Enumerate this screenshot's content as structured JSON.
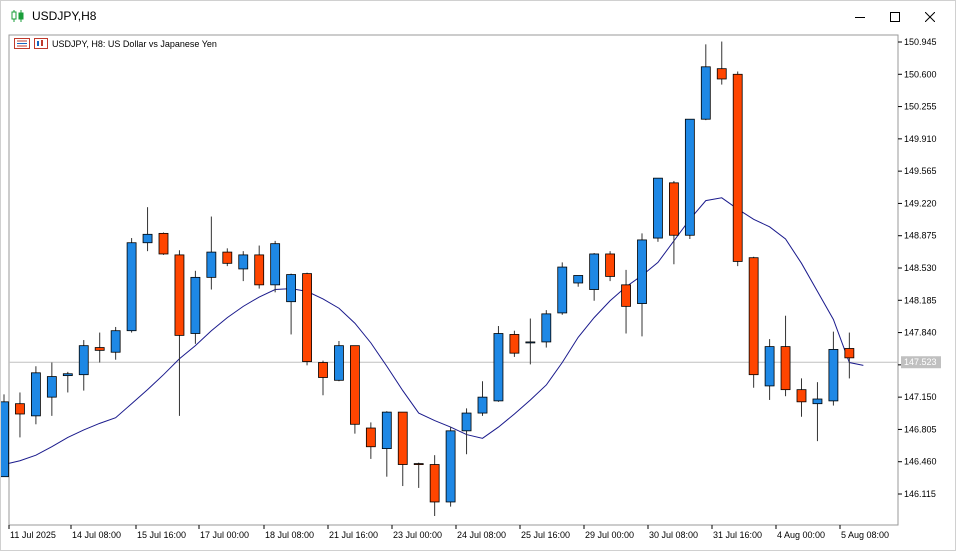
{
  "window": {
    "title": "USDJPY,H8",
    "minimize_icon": "minimize-icon",
    "maximize_icon": "maximize-icon",
    "close_icon": "close-icon"
  },
  "legend": {
    "text": "USDJPY, H8:  US Dollar vs Japanese Yen"
  },
  "colors": {
    "bull": "#1e88e5",
    "bear": "#ff4500",
    "ma_line": "#1a1a8c",
    "wick": "#333333",
    "price_tag_bg": "#c0c0c0"
  },
  "chart_data": {
    "type": "candlestick",
    "symbol": "USDJPY",
    "timeframe": "H8",
    "y_ticks": [
      "150.945",
      "150.600",
      "150.255",
      "149.910",
      "149.565",
      "149.220",
      "148.875",
      "148.530",
      "148.185",
      "147.840",
      "147.495",
      "147.150",
      "146.805",
      "146.460",
      "146.115"
    ],
    "x_labels": [
      "11 Jul 2025",
      "14 Jul 08:00",
      "15 Jul 16:00",
      "17 Jul 00:00",
      "18 Jul 08:00",
      "21 Jul 16:00",
      "23 Jul 00:00",
      "24 Jul 08:00",
      "25 Jul 16:00",
      "29 Jul 00:00",
      "30 Jul 08:00",
      "31 Jul 16:00",
      "4 Aug 00:00",
      "5 Aug 08:00"
    ],
    "current_price": "147.523",
    "ylim": [
      145.88,
      151.0
    ],
    "candles": [
      {
        "o": 146.3,
        "h": 147.18,
        "l": 146.3,
        "c": 147.1
      },
      {
        "o": 147.08,
        "h": 147.2,
        "l": 146.72,
        "c": 146.97
      },
      {
        "o": 146.95,
        "h": 147.48,
        "l": 146.86,
        "c": 147.41
      },
      {
        "o": 147.15,
        "h": 147.52,
        "l": 146.95,
        "c": 147.37
      },
      {
        "o": 147.38,
        "h": 147.42,
        "l": 147.2,
        "c": 147.4
      },
      {
        "o": 147.39,
        "h": 147.76,
        "l": 147.22,
        "c": 147.7
      },
      {
        "o": 147.68,
        "h": 147.84,
        "l": 147.52,
        "c": 147.65
      },
      {
        "o": 147.63,
        "h": 147.9,
        "l": 147.55,
        "c": 147.86
      },
      {
        "o": 147.86,
        "h": 148.85,
        "l": 147.84,
        "c": 148.8
      },
      {
        "o": 148.8,
        "h": 149.18,
        "l": 148.71,
        "c": 148.89
      },
      {
        "o": 148.9,
        "h": 148.91,
        "l": 148.67,
        "c": 148.68
      },
      {
        "o": 148.67,
        "h": 148.72,
        "l": 146.95,
        "c": 147.81
      },
      {
        "o": 147.83,
        "h": 148.5,
        "l": 147.72,
        "c": 148.43
      },
      {
        "o": 148.43,
        "h": 149.08,
        "l": 148.3,
        "c": 148.7
      },
      {
        "o": 148.7,
        "h": 148.74,
        "l": 148.55,
        "c": 148.58
      },
      {
        "o": 148.52,
        "h": 148.71,
        "l": 148.39,
        "c": 148.67
      },
      {
        "o": 148.67,
        "h": 148.77,
        "l": 148.31,
        "c": 148.35
      },
      {
        "o": 148.35,
        "h": 148.82,
        "l": 148.27,
        "c": 148.79
      },
      {
        "o": 148.17,
        "h": 148.47,
        "l": 147.82,
        "c": 148.46
      },
      {
        "o": 148.47,
        "h": 148.48,
        "l": 147.49,
        "c": 147.53
      },
      {
        "o": 147.52,
        "h": 147.54,
        "l": 147.17,
        "c": 147.36
      },
      {
        "o": 147.33,
        "h": 147.75,
        "l": 147.32,
        "c": 147.7
      },
      {
        "o": 147.7,
        "h": 147.7,
        "l": 146.76,
        "c": 146.86
      },
      {
        "o": 146.82,
        "h": 146.88,
        "l": 146.49,
        "c": 146.62
      },
      {
        "o": 146.6,
        "h": 147.0,
        "l": 146.3,
        "c": 146.99
      },
      {
        "o": 146.99,
        "h": 146.98,
        "l": 146.2,
        "c": 146.43
      },
      {
        "o": 146.44,
        "h": 146.45,
        "l": 146.18,
        "c": 146.43
      },
      {
        "o": 146.43,
        "h": 146.53,
        "l": 145.88,
        "c": 146.03
      },
      {
        "o": 146.03,
        "h": 146.83,
        "l": 145.98,
        "c": 146.79
      },
      {
        "o": 146.79,
        "h": 147.03,
        "l": 146.54,
        "c": 146.98
      },
      {
        "o": 146.98,
        "h": 147.32,
        "l": 146.95,
        "c": 147.15
      },
      {
        "o": 147.11,
        "h": 147.91,
        "l": 147.1,
        "c": 147.83
      },
      {
        "o": 147.82,
        "h": 147.86,
        "l": 147.58,
        "c": 147.62
      },
      {
        "o": 147.74,
        "h": 147.99,
        "l": 147.5,
        "c": 147.74
      },
      {
        "o": 147.74,
        "h": 148.08,
        "l": 147.68,
        "c": 148.04
      },
      {
        "o": 148.05,
        "h": 148.59,
        "l": 148.03,
        "c": 148.54
      },
      {
        "o": 148.37,
        "h": 148.45,
        "l": 148.33,
        "c": 148.45
      },
      {
        "o": 148.3,
        "h": 148.69,
        "l": 148.18,
        "c": 148.68
      },
      {
        "o": 148.68,
        "h": 148.71,
        "l": 148.39,
        "c": 148.44
      },
      {
        "o": 148.35,
        "h": 148.51,
        "l": 147.83,
        "c": 148.12
      },
      {
        "o": 148.15,
        "h": 148.9,
        "l": 147.8,
        "c": 148.83
      },
      {
        "o": 148.85,
        "h": 149.33,
        "l": 148.81,
        "c": 149.49
      },
      {
        "o": 149.44,
        "h": 149.46,
        "l": 148.57,
        "c": 148.88
      },
      {
        "o": 148.88,
        "h": 150.05,
        "l": 148.84,
        "c": 150.12
      },
      {
        "o": 150.12,
        "h": 150.92,
        "l": 150.11,
        "c": 150.68
      },
      {
        "o": 150.66,
        "h": 150.95,
        "l": 150.49,
        "c": 150.55
      },
      {
        "o": 150.6,
        "h": 150.63,
        "l": 148.55,
        "c": 148.6
      },
      {
        "o": 148.64,
        "h": 148.65,
        "l": 147.25,
        "c": 147.39
      },
      {
        "o": 147.27,
        "h": 147.77,
        "l": 147.12,
        "c": 147.69
      },
      {
        "o": 147.69,
        "h": 148.02,
        "l": 147.16,
        "c": 147.23
      },
      {
        "o": 147.23,
        "h": 147.35,
        "l": 146.94,
        "c": 147.1
      },
      {
        "o": 147.08,
        "h": 147.31,
        "l": 146.68,
        "c": 147.13
      },
      {
        "o": 147.11,
        "h": 147.85,
        "l": 147.06,
        "c": 147.66
      },
      {
        "o": 147.67,
        "h": 147.84,
        "l": 147.35,
        "c": 147.57
      }
    ],
    "ma": [
      146.43,
      146.47,
      146.53,
      146.62,
      146.72,
      146.8,
      146.87,
      146.93,
      147.08,
      147.23,
      147.39,
      147.56,
      147.7,
      147.86,
      148.0,
      148.12,
      148.22,
      148.3,
      148.31,
      148.28,
      148.2,
      148.1,
      147.94,
      147.73,
      147.48,
      147.22,
      146.98,
      146.9,
      146.83,
      146.75,
      146.71,
      146.83,
      146.97,
      147.12,
      147.28,
      147.52,
      147.79,
      148.0,
      148.18,
      148.33,
      148.45,
      148.59,
      148.82,
      149.05,
      149.25,
      149.28,
      149.16,
      149.05,
      148.97,
      148.84,
      148.58,
      148.28,
      147.98,
      147.52
    ]
  }
}
